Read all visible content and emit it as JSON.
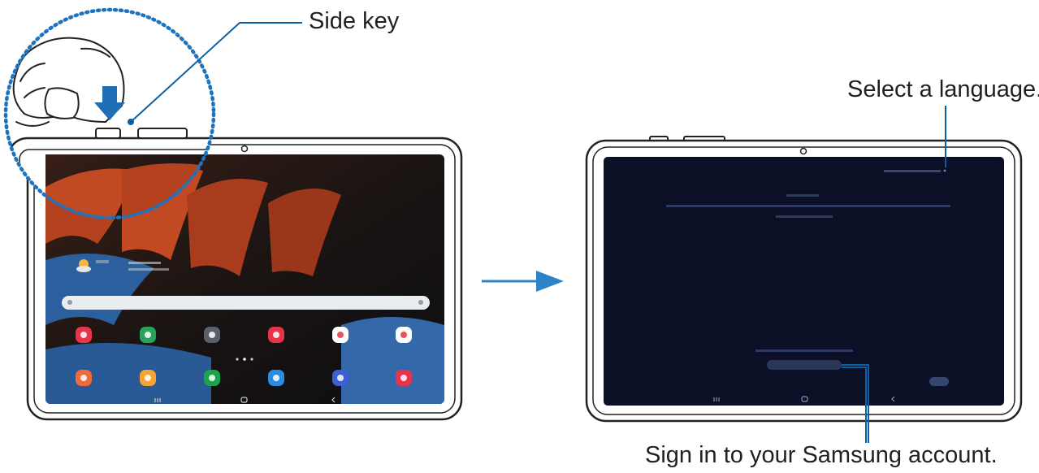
{
  "callouts": {
    "side_key": "Side key",
    "select_language": "Select a language.",
    "sign_in": "Sign in to your Samsung account."
  },
  "colors": {
    "leader_line": "#0b5fa5",
    "dotted_circle": "#1e73be",
    "arrow": "#2e83c6",
    "tablet_frame": "#222222",
    "setup_screen": "#0b1026"
  },
  "home_screen": {
    "app_icon_colors_row1": [
      "#e8334a",
      "#27a35c",
      "#5a5f6a",
      "#e8334a",
      "#ffffff",
      "#ffffff"
    ],
    "app_icon_colors_row2": [
      "#f06a3a",
      "#f4a533",
      "#1ba34f",
      "#2a8cde",
      "#3d5fd6",
      "#e8334a"
    ]
  }
}
